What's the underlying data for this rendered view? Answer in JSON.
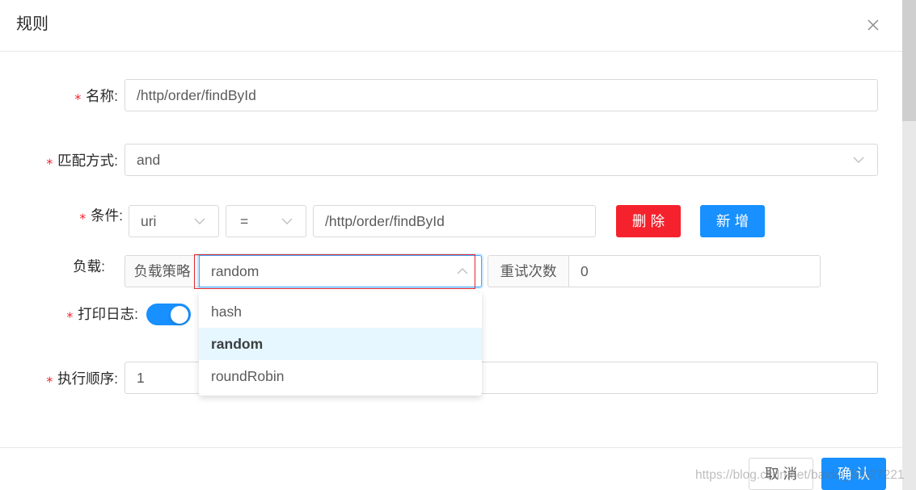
{
  "dialog": {
    "title": "规则"
  },
  "form": {
    "required_mark": "*",
    "name": {
      "label": "名称:",
      "value": "/http/order/findById"
    },
    "match_mode": {
      "label": "匹配方式:",
      "value": "and"
    },
    "condition": {
      "label": "条件:",
      "field": "uri",
      "operator": "=",
      "value": "/http/order/findById",
      "delete_label": "删除",
      "add_label": "新增"
    },
    "load": {
      "label": "负载:",
      "strategy_addon": "负载策略",
      "strategy_value": "random",
      "strategy_options": [
        "hash",
        "random",
        "roundRobin"
      ],
      "retry_addon": "重试次数",
      "retry_value": "0"
    },
    "log": {
      "label": "打印日志:",
      "enabled": true
    },
    "order": {
      "label": "执行顺序:",
      "value": "1"
    }
  },
  "footer": {
    "cancel_label": "取消",
    "confirm_label": "确认"
  },
  "watermark": "https://blog.csdn.net/baidu_38627221",
  "icons": {
    "close": "close-icon",
    "select_closed": "chevron-down-icon",
    "select_open": "chevron-up-icon"
  },
  "colors": {
    "primary": "#1890ff",
    "danger": "#f5222d",
    "required": "#f5222d",
    "option_active_bg": "#e6f7ff",
    "annotation": "#e0282e"
  }
}
